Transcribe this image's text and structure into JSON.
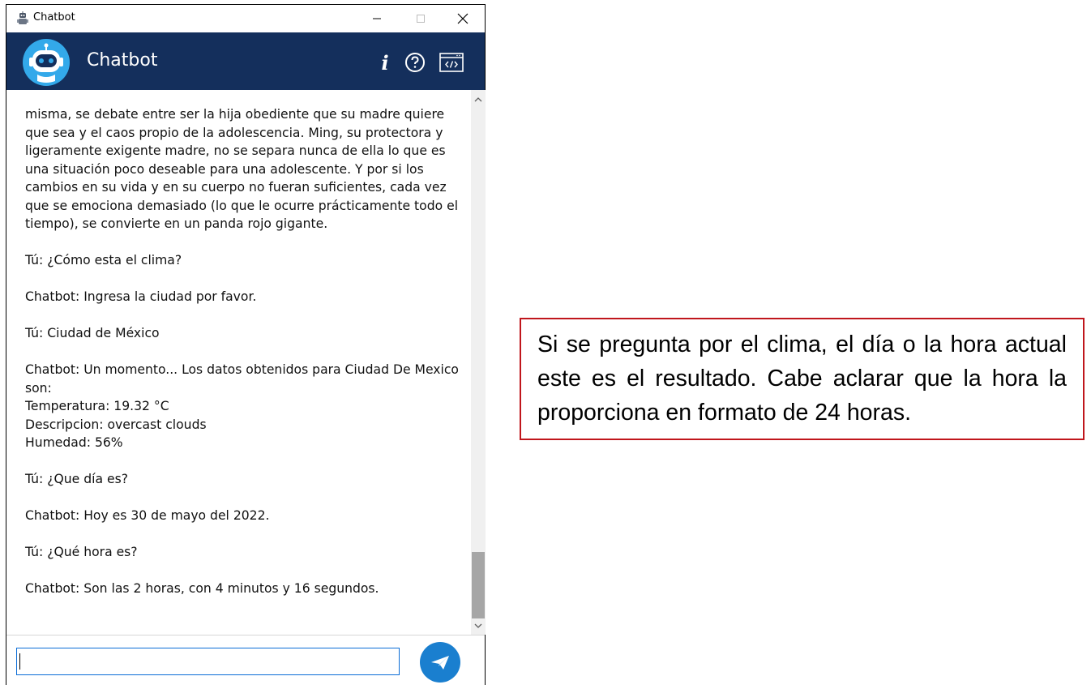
{
  "window": {
    "title": "Chatbot",
    "controls": {
      "minimize": "–",
      "maximize": "□",
      "close": "×"
    }
  },
  "header": {
    "title": "Chatbot",
    "info_label": "i",
    "brand_color": "#142f5c",
    "icons": [
      "robot-avatar",
      "info-icon",
      "help-icon",
      "code-window-icon"
    ]
  },
  "messages": [
    "misma, se debate entre ser la hija obediente que su madre quiere que sea y el caos propio de la adolescencia. Ming, su protectora y ligeramente exigente madre, no se separa nunca de ella lo que es una situación poco deseable para una adolescente. Y por si los cambios en su vida y en su cuerpo no fueran suficientes, cada vez que se emociona demasiado (lo que le ocurre prácticamente todo el tiempo), se convierte en un panda rojo gigante.",
    "Tú: ¿Cómo esta el clima?",
    "Chatbot: Ingresa la ciudad por favor.",
    "Tú: Ciudad de México",
    "Chatbot: Un momento... Los datos obtenidos para Ciudad De Mexico son:\nTemperatura: 19.32 °C\nDescripcion: overcast clouds\nHumedad: 56%",
    "Tú: ¿Que día es?",
    "Chatbot: Hoy es 30 de mayo del 2022.",
    "Tú: ¿Qué hora es?",
    "Chatbot: Son las 2 horas, con 4 minutos y 16 segundos."
  ],
  "input": {
    "value": "",
    "placeholder": ""
  },
  "send_button": {
    "icon": "send-icon",
    "color": "#1a7fcf"
  },
  "annotation": {
    "text": "Si se pregunta por el clima, el día o la hora actual este es el resultado. Cabe aclarar que la hora la proporciona en formato de 24 horas.",
    "border_color": "#c0161c"
  }
}
